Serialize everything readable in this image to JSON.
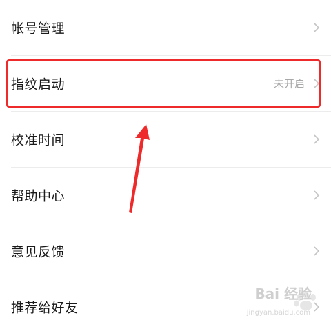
{
  "settings": {
    "items": [
      {
        "label": "帐号管理",
        "value": ""
      },
      {
        "label": "指纹启动",
        "value": "未开启"
      },
      {
        "label": "校准时间",
        "value": ""
      },
      {
        "label": "帮助中心",
        "value": ""
      },
      {
        "label": "意见反馈",
        "value": ""
      },
      {
        "label": "推荐给好友",
        "value": ""
      }
    ]
  },
  "annotation": {
    "highlight_color": "#ee2a2a"
  },
  "watermark": {
    "brand": "Bai 经验",
    "url": "jingyan.baidu.com"
  }
}
